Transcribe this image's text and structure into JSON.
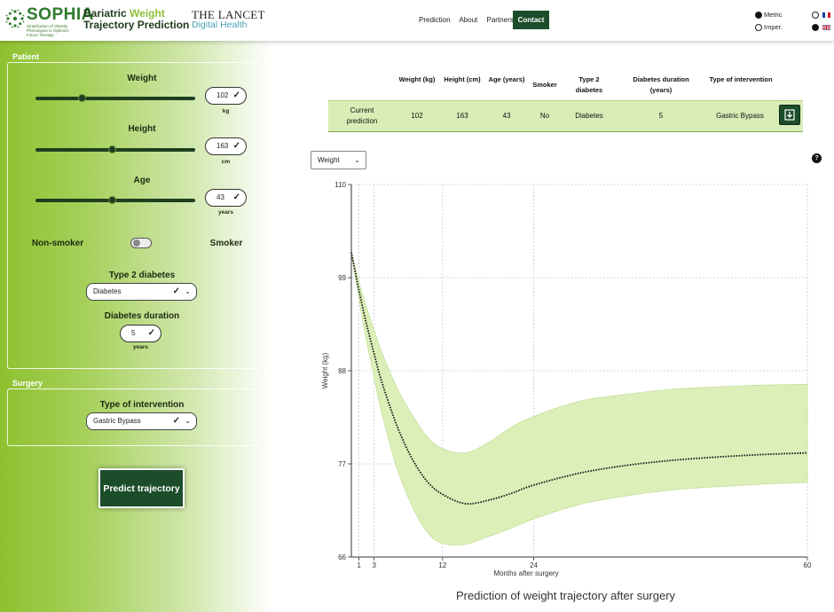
{
  "header": {
    "logo_text": "SOPHIA",
    "logo_sub": "Stratification of Obesity Phenotypes to Optimize Future Therapy",
    "title_part1": "Bariatric ",
    "title_accent": "Weight",
    "title_line2": "Trajectory Prediction",
    "lancet_line1": "THE LANCET",
    "lancet_line2": "Digital Health",
    "nav": [
      "Prediction",
      "About",
      "Partners"
    ],
    "contact_label": "Contact",
    "unit_metric": "Metric",
    "unit_imperial": "Imper."
  },
  "patient": {
    "section_title": "Patient",
    "weight_label": "Weight",
    "weight_value": "102",
    "weight_unit": "kg",
    "weight_slider_fraction": 0.29,
    "height_label": "Height",
    "height_value": "163",
    "height_unit": "cm",
    "height_slider_fraction": 0.48,
    "age_label": "Age",
    "age_value": "43",
    "age_unit": "years",
    "age_slider_fraction": 0.48,
    "nonsmoker_label": "Non-smoker",
    "smoker_label": "Smoker",
    "diabetes_label": "Type 2 diabetes",
    "diabetes_value": "Diabetes",
    "duration_label": "Diabetes duration",
    "duration_value": "5",
    "duration_unit": "years"
  },
  "surgery": {
    "section_title": "Surgery",
    "intervention_label": "Type of intervention",
    "intervention_value": "Gastric Bypass",
    "predict_label": "Predict trajectory"
  },
  "table": {
    "headers": [
      "Weight (kg)",
      "Height (cm)",
      "Age (years)",
      "Smoker",
      "Type 2 diabetes",
      "Diabetes duration (years)",
      "Type of intervention"
    ],
    "row_label": "Current prediction",
    "row": [
      "102",
      "163",
      "43",
      "No",
      "Diabetes",
      "5",
      "Gastric Bypass"
    ]
  },
  "chart_controls": {
    "variable": "Weight",
    "help": "?"
  },
  "chart_data": {
    "type": "line",
    "title": "Prediction of weight trajectory after surgery",
    "xlabel": "Months after surgery",
    "ylabel": "Weight (kg)",
    "xlim": [
      0,
      60
    ],
    "ylim": [
      66,
      110
    ],
    "x_ticks": [
      1,
      3,
      12,
      24,
      60
    ],
    "y_ticks": [
      66,
      77,
      88,
      99,
      110
    ],
    "grid": true,
    "series": [
      {
        "x": [
          0,
          1,
          2,
          3,
          4,
          6,
          8,
          10,
          12,
          15,
          18,
          21,
          24,
          30,
          36,
          42,
          48,
          54,
          60
        ],
        "y": [
          102,
          97.5,
          93.5,
          90,
          86.7,
          81.5,
          77.6,
          74.9,
          73.4,
          72.3,
          72.7,
          73.5,
          74.5,
          75.9,
          76.8,
          77.4,
          77.8,
          78.1,
          78.3
        ]
      }
    ],
    "band": {
      "x": [
        0,
        1,
        2,
        3,
        4,
        6,
        8,
        10,
        12,
        15,
        18,
        21,
        24,
        30,
        36,
        42,
        48,
        54,
        60
      ],
      "upper": [
        102,
        98.5,
        95.5,
        92.8,
        90.2,
        86,
        82.8,
        80.2,
        78.8,
        78.3,
        79.5,
        81.3,
        82.6,
        84.4,
        85.2,
        85.8,
        86.1,
        86.3,
        86.4
      ],
      "lower": [
        102,
        96.5,
        91.5,
        87.2,
        83,
        76.5,
        72,
        68.9,
        67.6,
        67.5,
        68.4,
        69.4,
        70.5,
        72.2,
        73.2,
        73.9,
        74.3,
        74.6,
        74.8
      ]
    },
    "colors": {
      "band": "#ddefb8",
      "band_edge": "#b8d98a",
      "line": "#1a1a1a"
    }
  }
}
